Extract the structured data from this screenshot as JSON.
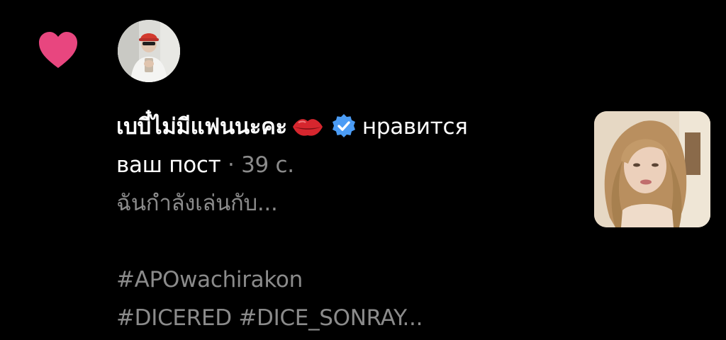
{
  "notification": {
    "username": "เบบี๋ไม่มีแฟนนะคะ",
    "action_part1": "нравится",
    "action_part2": "ваш пост",
    "separator": " · ",
    "time": "39 с.",
    "caption_line1": "ฉันกำลังเล่นกับ...",
    "caption_line2": "#APOwachirakon",
    "caption_line3": "#DICERED #DICE_SONRAY..."
  },
  "icons": {
    "like": "heart-icon",
    "emoji": "kiss-lips-icon",
    "verified": "verified-badge-icon"
  },
  "colors": {
    "background": "#000000",
    "heart": "#e8467f",
    "verified": "#4b9cf5",
    "text_primary": "#ffffff",
    "text_secondary": "#8b8b8b"
  }
}
